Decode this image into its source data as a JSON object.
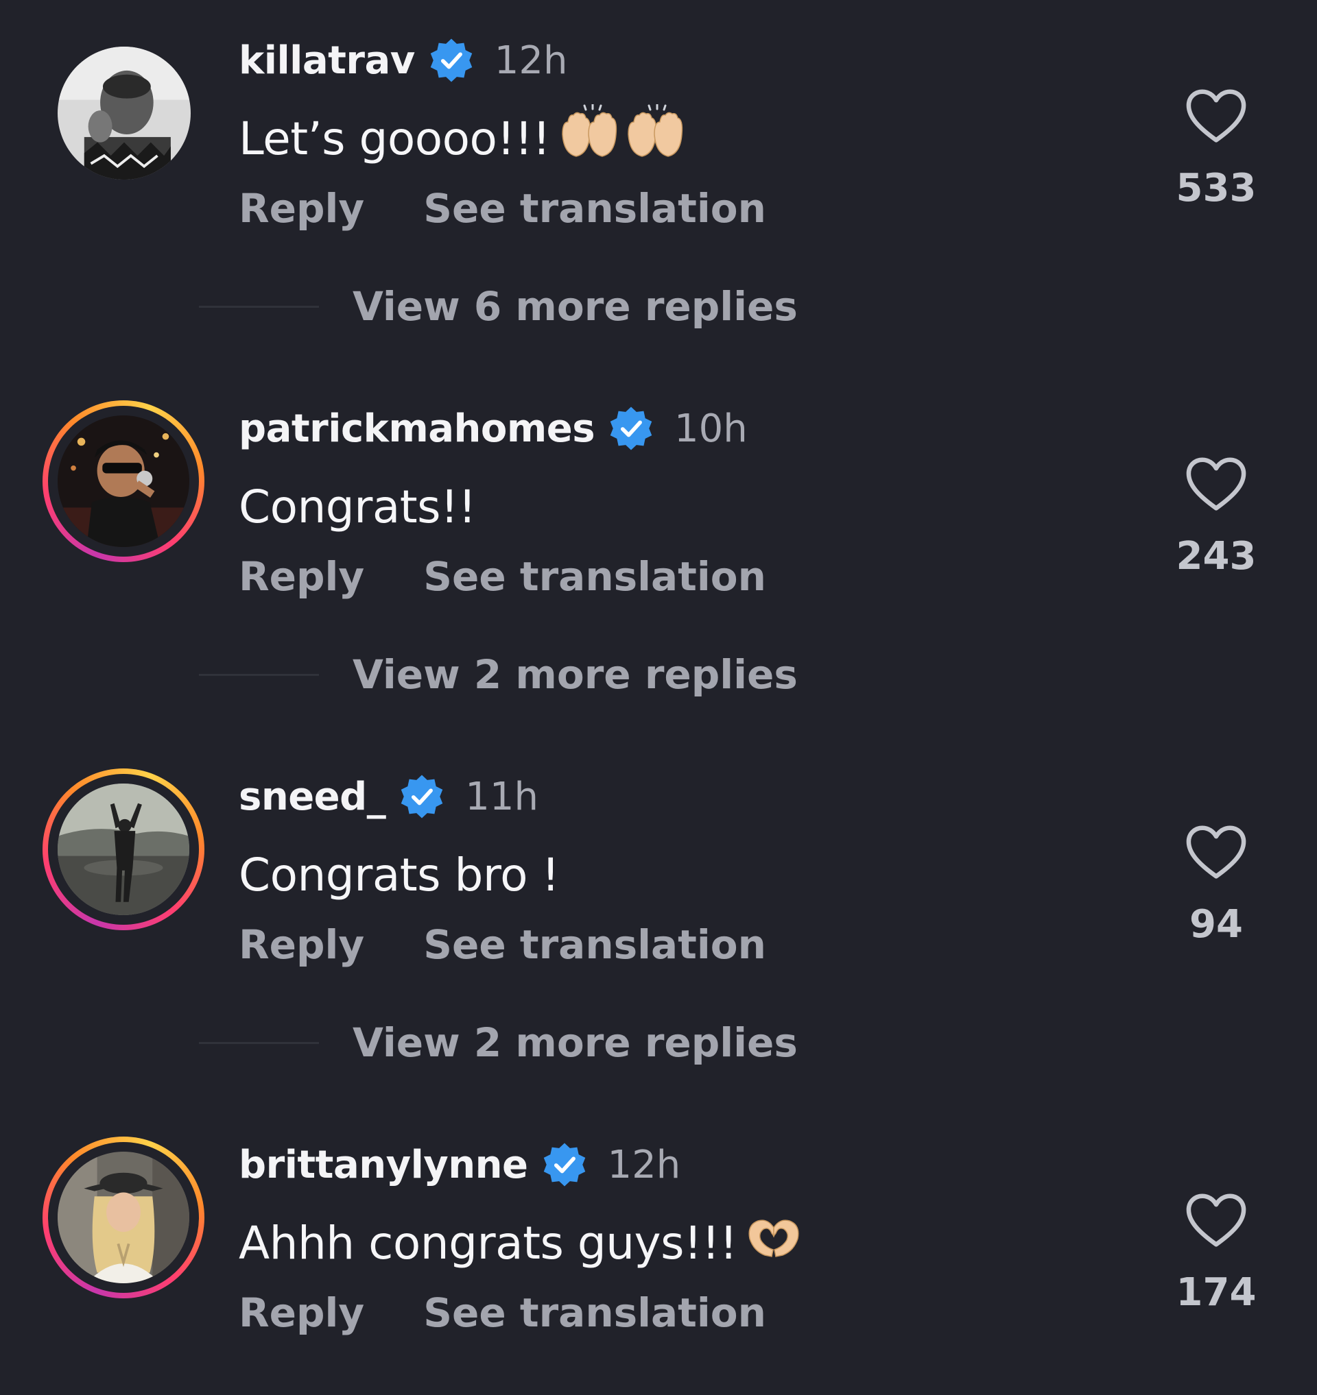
{
  "comments": [
    {
      "username": "killatrav",
      "verified": true,
      "time": "12h",
      "text": "Let’s goooo!!!",
      "emoji": "raising-hands",
      "reply_label": "Reply",
      "translate_label": "See translation",
      "likes": "533",
      "has_story_ring": false
    },
    {
      "username": "patrickmahomes",
      "verified": true,
      "time": "10h",
      "text": "Congrats!!",
      "emoji": "",
      "reply_label": "Reply",
      "translate_label": "See translation",
      "likes": "243",
      "has_story_ring": true
    },
    {
      "username": "sneed_",
      "verified": true,
      "time": "11h",
      "text": "Congrats bro !",
      "emoji": "",
      "reply_label": "Reply",
      "translate_label": "See translation",
      "likes": "94",
      "has_story_ring": true
    },
    {
      "username": "brittanylynne",
      "verified": true,
      "time": "12h",
      "text": "Ahhh congrats guys!!!",
      "emoji": "heart-hands",
      "reply_label": "Reply",
      "translate_label": "See translation",
      "likes": "174",
      "has_story_ring": true
    }
  ],
  "view_more": [
    "View 6 more replies",
    "View 2 more replies",
    "View 2 more replies"
  ],
  "colors": {
    "background": "#21222a",
    "verified_badge": "#3897f0",
    "secondary_text": "#a3a5ae"
  },
  "icons": {
    "verified": "verified-badge-icon",
    "like": "heart-outline-icon"
  }
}
